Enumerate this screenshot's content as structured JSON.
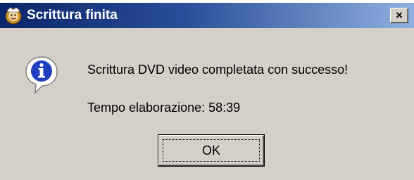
{
  "window": {
    "title": "Scrittura finita",
    "app_icon": "dvd-app-icon",
    "close_label": "×"
  },
  "dialog": {
    "icon": "info-icon",
    "message": "Scrittura DVD video completata con successo!",
    "elapsed_time": "Tempo elaborazione: 58:39",
    "ok_label": "OK"
  },
  "colors": {
    "titlebar_start": "#0a246a",
    "titlebar_end": "#8fb0e0",
    "dialog_background": "#d4d0c8",
    "info_icon": "#1f3fbf"
  }
}
